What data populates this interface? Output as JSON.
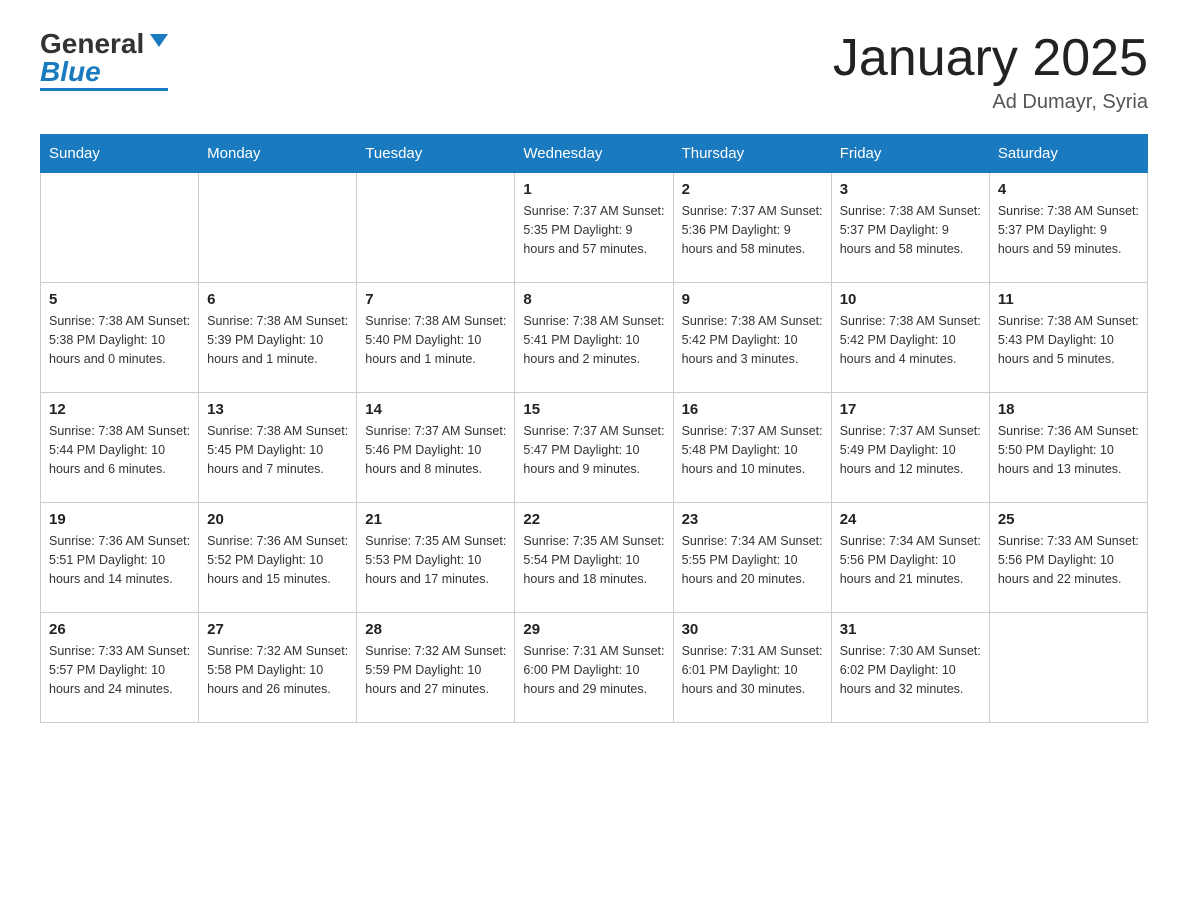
{
  "header": {
    "logo_text_black": "General",
    "logo_text_blue": "Blue",
    "main_title": "January 2025",
    "subtitle": "Ad Dumayr, Syria"
  },
  "calendar": {
    "days_of_week": [
      "Sunday",
      "Monday",
      "Tuesday",
      "Wednesday",
      "Thursday",
      "Friday",
      "Saturday"
    ],
    "weeks": [
      [
        {
          "day": "",
          "info": ""
        },
        {
          "day": "",
          "info": ""
        },
        {
          "day": "",
          "info": ""
        },
        {
          "day": "1",
          "info": "Sunrise: 7:37 AM\nSunset: 5:35 PM\nDaylight: 9 hours\nand 57 minutes."
        },
        {
          "day": "2",
          "info": "Sunrise: 7:37 AM\nSunset: 5:36 PM\nDaylight: 9 hours\nand 58 minutes."
        },
        {
          "day": "3",
          "info": "Sunrise: 7:38 AM\nSunset: 5:37 PM\nDaylight: 9 hours\nand 58 minutes."
        },
        {
          "day": "4",
          "info": "Sunrise: 7:38 AM\nSunset: 5:37 PM\nDaylight: 9 hours\nand 59 minutes."
        }
      ],
      [
        {
          "day": "5",
          "info": "Sunrise: 7:38 AM\nSunset: 5:38 PM\nDaylight: 10 hours\nand 0 minutes."
        },
        {
          "day": "6",
          "info": "Sunrise: 7:38 AM\nSunset: 5:39 PM\nDaylight: 10 hours\nand 1 minute."
        },
        {
          "day": "7",
          "info": "Sunrise: 7:38 AM\nSunset: 5:40 PM\nDaylight: 10 hours\nand 1 minute."
        },
        {
          "day": "8",
          "info": "Sunrise: 7:38 AM\nSunset: 5:41 PM\nDaylight: 10 hours\nand 2 minutes."
        },
        {
          "day": "9",
          "info": "Sunrise: 7:38 AM\nSunset: 5:42 PM\nDaylight: 10 hours\nand 3 minutes."
        },
        {
          "day": "10",
          "info": "Sunrise: 7:38 AM\nSunset: 5:42 PM\nDaylight: 10 hours\nand 4 minutes."
        },
        {
          "day": "11",
          "info": "Sunrise: 7:38 AM\nSunset: 5:43 PM\nDaylight: 10 hours\nand 5 minutes."
        }
      ],
      [
        {
          "day": "12",
          "info": "Sunrise: 7:38 AM\nSunset: 5:44 PM\nDaylight: 10 hours\nand 6 minutes."
        },
        {
          "day": "13",
          "info": "Sunrise: 7:38 AM\nSunset: 5:45 PM\nDaylight: 10 hours\nand 7 minutes."
        },
        {
          "day": "14",
          "info": "Sunrise: 7:37 AM\nSunset: 5:46 PM\nDaylight: 10 hours\nand 8 minutes."
        },
        {
          "day": "15",
          "info": "Sunrise: 7:37 AM\nSunset: 5:47 PM\nDaylight: 10 hours\nand 9 minutes."
        },
        {
          "day": "16",
          "info": "Sunrise: 7:37 AM\nSunset: 5:48 PM\nDaylight: 10 hours\nand 10 minutes."
        },
        {
          "day": "17",
          "info": "Sunrise: 7:37 AM\nSunset: 5:49 PM\nDaylight: 10 hours\nand 12 minutes."
        },
        {
          "day": "18",
          "info": "Sunrise: 7:36 AM\nSunset: 5:50 PM\nDaylight: 10 hours\nand 13 minutes."
        }
      ],
      [
        {
          "day": "19",
          "info": "Sunrise: 7:36 AM\nSunset: 5:51 PM\nDaylight: 10 hours\nand 14 minutes."
        },
        {
          "day": "20",
          "info": "Sunrise: 7:36 AM\nSunset: 5:52 PM\nDaylight: 10 hours\nand 15 minutes."
        },
        {
          "day": "21",
          "info": "Sunrise: 7:35 AM\nSunset: 5:53 PM\nDaylight: 10 hours\nand 17 minutes."
        },
        {
          "day": "22",
          "info": "Sunrise: 7:35 AM\nSunset: 5:54 PM\nDaylight: 10 hours\nand 18 minutes."
        },
        {
          "day": "23",
          "info": "Sunrise: 7:34 AM\nSunset: 5:55 PM\nDaylight: 10 hours\nand 20 minutes."
        },
        {
          "day": "24",
          "info": "Sunrise: 7:34 AM\nSunset: 5:56 PM\nDaylight: 10 hours\nand 21 minutes."
        },
        {
          "day": "25",
          "info": "Sunrise: 7:33 AM\nSunset: 5:56 PM\nDaylight: 10 hours\nand 22 minutes."
        }
      ],
      [
        {
          "day": "26",
          "info": "Sunrise: 7:33 AM\nSunset: 5:57 PM\nDaylight: 10 hours\nand 24 minutes."
        },
        {
          "day": "27",
          "info": "Sunrise: 7:32 AM\nSunset: 5:58 PM\nDaylight: 10 hours\nand 26 minutes."
        },
        {
          "day": "28",
          "info": "Sunrise: 7:32 AM\nSunset: 5:59 PM\nDaylight: 10 hours\nand 27 minutes."
        },
        {
          "day": "29",
          "info": "Sunrise: 7:31 AM\nSunset: 6:00 PM\nDaylight: 10 hours\nand 29 minutes."
        },
        {
          "day": "30",
          "info": "Sunrise: 7:31 AM\nSunset: 6:01 PM\nDaylight: 10 hours\nand 30 minutes."
        },
        {
          "day": "31",
          "info": "Sunrise: 7:30 AM\nSunset: 6:02 PM\nDaylight: 10 hours\nand 32 minutes."
        },
        {
          "day": "",
          "info": ""
        }
      ]
    ]
  }
}
